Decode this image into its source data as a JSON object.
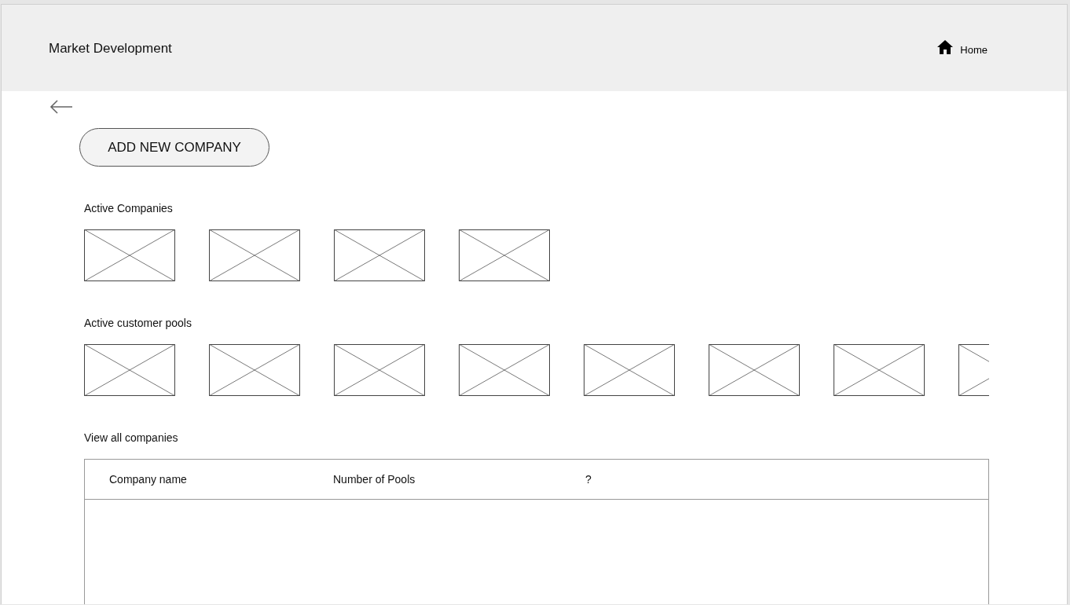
{
  "header": {
    "title": "Market Development",
    "home_link": "Home"
  },
  "add_button": "ADD NEW COMPANY",
  "active_companies": {
    "heading": "Active Companies",
    "tiles": [
      {
        "kind": "placeholder"
      },
      {
        "kind": "placeholder"
      },
      {
        "kind": "placeholder"
      },
      {
        "kind": "placeholder"
      }
    ]
  },
  "active_customer_pools": {
    "heading": "Active customer pools",
    "tiles": [
      {
        "kind": "placeholder"
      },
      {
        "kind": "placeholder"
      },
      {
        "kind": "placeholder"
      },
      {
        "kind": "placeholder"
      },
      {
        "kind": "placeholder"
      },
      {
        "kind": "placeholder"
      },
      {
        "kind": "placeholder"
      },
      {
        "kind": "placeholder"
      }
    ]
  },
  "all_companies": {
    "heading": "View all companies",
    "table": {
      "columns": [
        "Company name",
        "Number of Pools",
        "?"
      ]
    }
  }
}
